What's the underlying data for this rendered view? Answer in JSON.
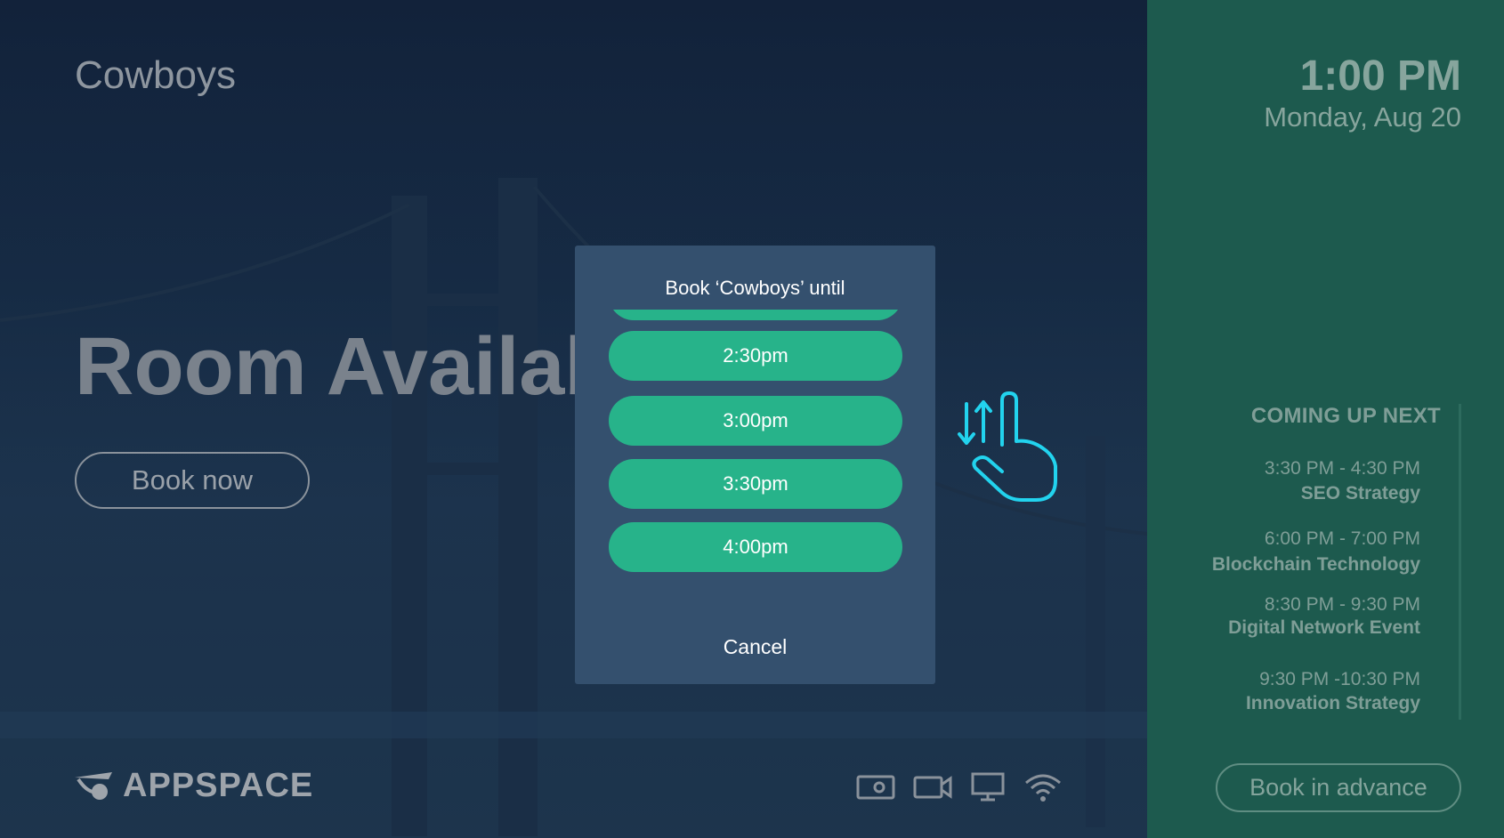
{
  "room": {
    "name": "Cowboys",
    "status": "Room Available"
  },
  "actions": {
    "book_now": "Book now",
    "book_in_advance": "Book in advance"
  },
  "brand": {
    "logo_text": "APPSPACE"
  },
  "clock": {
    "time": "1:00 PM",
    "date": "Monday, Aug 20"
  },
  "coming_up": {
    "heading": "COMING UP NEXT",
    "events": [
      {
        "time": "3:30 PM - 4:30 PM",
        "title": "SEO Strategy"
      },
      {
        "time": "6:00 PM - 7:00 PM",
        "title": "Blockchain Technology"
      },
      {
        "time": "8:30 PM - 9:30 PM",
        "title": "Digital Network Event"
      },
      {
        "time": "9:30 PM -10:30 PM",
        "title": "Innovation Strategy"
      }
    ]
  },
  "dialog": {
    "title": "Book ‘Cowboys’ until",
    "options": [
      "2:30pm",
      "3:00pm",
      "3:30pm",
      "4:00pm"
    ],
    "partial_option": "",
    "cancel": "Cancel"
  },
  "status_icons": [
    "projector-icon",
    "video-camera-icon",
    "monitor-icon",
    "wifi-icon"
  ],
  "colors": {
    "background": "#162b45",
    "side_panel": "#1d5a4e",
    "dialog": "#34506e",
    "option_button": "#27b38a",
    "gesture_hint": "#22d3ee"
  }
}
